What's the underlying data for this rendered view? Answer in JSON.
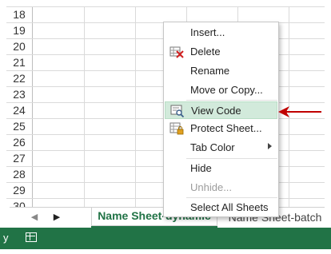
{
  "rows": [
    "18",
    "19",
    "20",
    "21",
    "22",
    "23",
    "24",
    "25",
    "26",
    "27",
    "28",
    "29",
    "30"
  ],
  "menu": {
    "items": [
      {
        "label": "Insert...",
        "icon": "none",
        "disabled": false,
        "highlighted": false,
        "submenu": false
      },
      {
        "label": "Delete",
        "icon": "delete-sheet-icon",
        "disabled": false,
        "highlighted": false,
        "submenu": false
      },
      {
        "label": "Rename",
        "icon": "none",
        "disabled": false,
        "highlighted": false,
        "submenu": false
      },
      {
        "label": "Move or Copy...",
        "icon": "none",
        "disabled": false,
        "highlighted": false,
        "submenu": false
      },
      {
        "label": "View Code",
        "icon": "view-code-icon",
        "disabled": false,
        "highlighted": true,
        "submenu": false
      },
      {
        "label": "Protect Sheet...",
        "icon": "protect-sheet-icon",
        "disabled": false,
        "highlighted": false,
        "submenu": false
      },
      {
        "label": "Tab Color",
        "icon": "none",
        "disabled": false,
        "highlighted": false,
        "submenu": true
      },
      {
        "label": "Hide",
        "icon": "none",
        "disabled": false,
        "highlighted": false,
        "submenu": false
      },
      {
        "label": "Unhide...",
        "icon": "none",
        "disabled": true,
        "highlighted": false,
        "submenu": false
      },
      {
        "label": "Select All Sheets",
        "icon": "none",
        "disabled": false,
        "highlighted": false,
        "submenu": false
      }
    ]
  },
  "tabs": {
    "active": "Name Sheet-dynamic",
    "inactive": "Name Sheet-batch"
  },
  "status": {
    "mode_text": "y"
  },
  "colors": {
    "excel_green": "#217346",
    "highlight": "#d2eadb",
    "pointer_red": "#c00000"
  }
}
